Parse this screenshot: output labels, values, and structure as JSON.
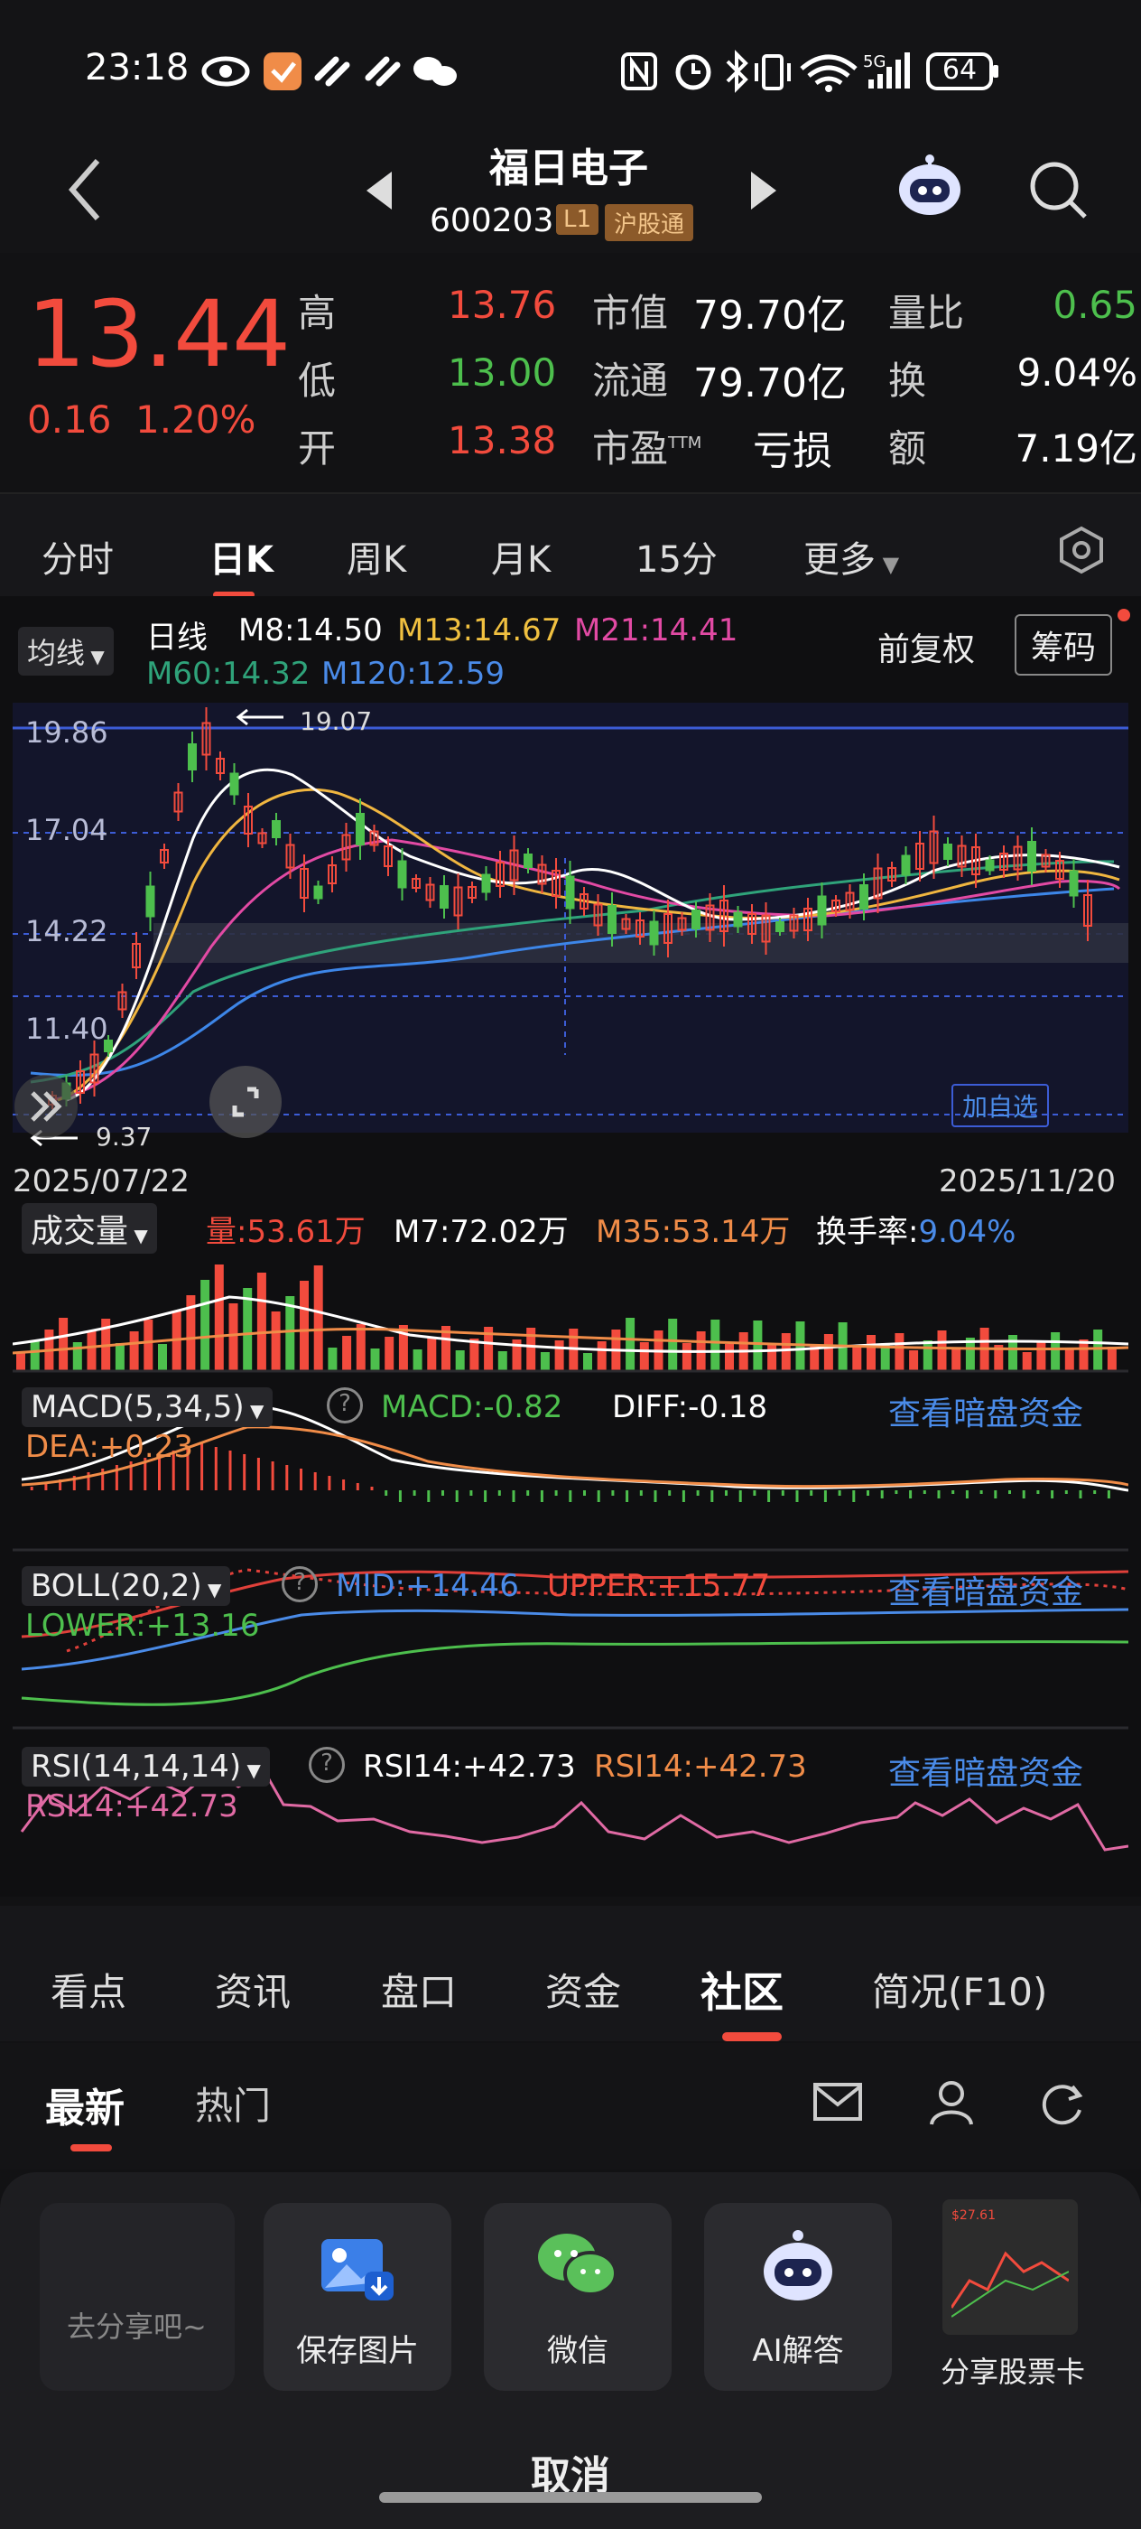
{
  "status": {
    "time": "23:18",
    "signal": "5G",
    "battery": "64"
  },
  "header": {
    "name": "福日电子",
    "code": "600203",
    "badge_l1": "L1",
    "badge_hgt": "沪股通"
  },
  "quote": {
    "price": "13.44",
    "change": "0.16",
    "change_pct": "1.20%",
    "rows": [
      {
        "l1": "高",
        "v1": "13.76",
        "l2": "市值",
        "v2": "79.70亿",
        "l3": "量比",
        "v3": "0.65"
      },
      {
        "l1": "低",
        "v1": "13.00",
        "l2": "流通",
        "v2": "79.70亿",
        "l3": "换",
        "v3": "9.04%"
      },
      {
        "l1": "开",
        "v1": "13.38",
        "l2": "市盈",
        "l2sup": "TTM",
        "v2": "亏损",
        "l3": "额",
        "v3": "7.19亿"
      }
    ]
  },
  "tabs": [
    "分时",
    "日K",
    "周K",
    "月K",
    "15分",
    "更多"
  ],
  "ma": {
    "selector": "均线",
    "period": "日线",
    "m8": "M8:14.50",
    "m13": "M13:14.67",
    "m21": "M21:14.41",
    "m60": "M60:14.32",
    "m120": "M120:12.59",
    "fuquan": "前复权",
    "chouma": "筹码"
  },
  "chart": {
    "y_labels": [
      "19.86",
      "17.04",
      "14.22",
      "11.40"
    ],
    "high_marker": "19.07",
    "low_marker": "9.37",
    "start_date": "2025/07/22",
    "end_date": "2025/11/20",
    "add_watch": "加自选"
  },
  "volume": {
    "selector": "成交量",
    "v": "量:53.61万",
    "m7": "M7:72.02万",
    "m35": "M35:53.14万",
    "turnover_label": "换手率:",
    "turnover": "9.04%"
  },
  "macd": {
    "selector": "MACD(5,34,5)",
    "macd": "MACD:-0.82",
    "diff": "DIFF:-0.18",
    "dea": "DEA:+0.23",
    "link": "查看暗盘资金"
  },
  "boll": {
    "selector": "BOLL(20,2)",
    "mid": "MID:+14.46",
    "upper": "UPPER:+15.77",
    "lower": "LOWER:+13.16",
    "link": "查看暗盘资金"
  },
  "rsi": {
    "selector": "RSI(14,14,14)",
    "r1": "RSI14:+42.73",
    "r2": "RSI14:+42.73",
    "r3": "RSI14:+42.73",
    "link": "查看暗盘资金"
  },
  "bottom_tabs": [
    "看点",
    "资讯",
    "盘口",
    "资金",
    "社区",
    "简况(F10)"
  ],
  "community": {
    "tab_new": "最新",
    "tab_hot": "热门"
  },
  "share": {
    "placeholder": "去分享吧~",
    "save": "保存图片",
    "wechat": "微信",
    "ai": "AI解答",
    "card": "分享股票卡",
    "card_price": "$27.61",
    "cancel": "取消"
  },
  "colors": {
    "up": "#f24b3d",
    "down": "#4dbf4d",
    "accent": "#4a8be8"
  }
}
